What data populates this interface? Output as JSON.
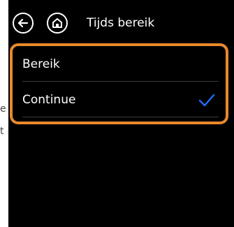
{
  "background": {
    "fragments": [
      "e",
      "t"
    ]
  },
  "header": {
    "title": "Tijds bereik",
    "back_icon": "back-arrow-icon",
    "home_icon": "home-icon"
  },
  "options": {
    "items": [
      {
        "label": "Bereik",
        "selected": false
      },
      {
        "label": "Continue",
        "selected": true
      }
    ]
  },
  "colors": {
    "screen_background": "#000000",
    "highlight_border": "#e8892b",
    "checkmark": "#1e6fff",
    "text": "#ffffff"
  }
}
